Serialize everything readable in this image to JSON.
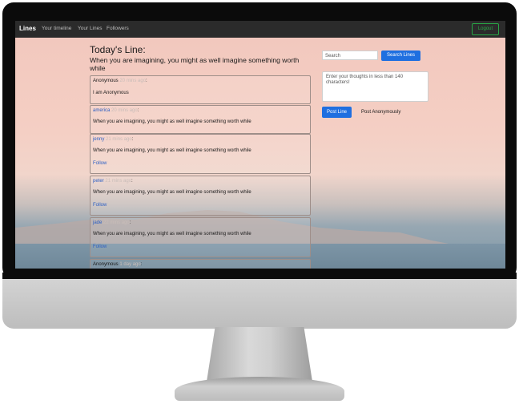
{
  "navbar": {
    "brand": "Lines",
    "links": [
      "Your timeline",
      "Your Lines",
      "Followers"
    ],
    "logout": "Logout"
  },
  "main": {
    "title": "Today's Line:",
    "today_line": "When you are imagining, you might as well imagine something worth while"
  },
  "feed": [
    {
      "author": "Anonymous",
      "time": "20 mins ago",
      "text": "I am Anonymous",
      "follow": ""
    },
    {
      "author": "america",
      "time": "20 mins ago",
      "text": "When you are imagining, you might as well imagine something worth while",
      "follow": ""
    },
    {
      "author": "jenny",
      "time": "21 mins ago",
      "text": "When you are imagining, you might as well imagine something worth while",
      "follow": "Follow"
    },
    {
      "author": "peter",
      "time": "21 mins ago",
      "text": "When you are imagining, you might as well imagine something worth while",
      "follow": "Follow"
    },
    {
      "author": "jade",
      "time": "22 mins ago",
      "text": "When you are imagining, you might as well imagine something worth while",
      "follow": "Follow"
    },
    {
      "author": "Anonymous",
      "time": "1 day ago",
      "text": "",
      "follow": ""
    }
  ],
  "sidebar": {
    "search_placeholder": "Search",
    "search_button": "Search Lines",
    "thoughts_placeholder": "Enter your thoughts in less than 140 characters!",
    "post_button": "Post Line",
    "post_anonymously": "Post Anonymously"
  },
  "colors": {
    "accent": "#1f6fe0",
    "logout": "#28a745",
    "navbar": "#2b2b2b"
  }
}
